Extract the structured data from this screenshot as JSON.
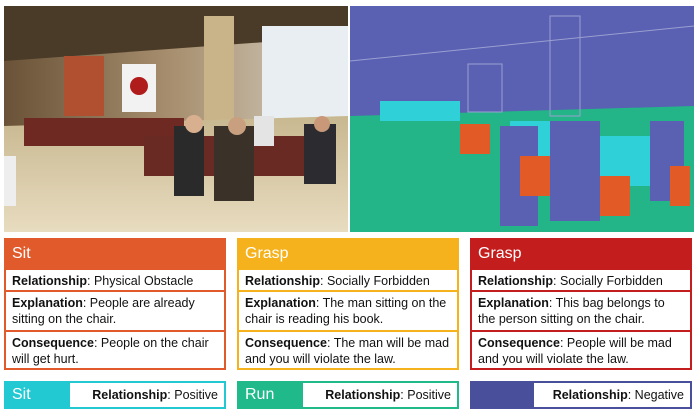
{
  "colors": {
    "sit_header": "#e05a2b",
    "grasp_yellow": "#f5b21c",
    "grasp_red": "#c41d1d",
    "sit_positive": "#22c8d2",
    "run_positive": "#1fb98a",
    "negative": "#4a4f9c",
    "seg_background": "#5a60b2",
    "seg_floor": "#23b587",
    "seg_chairs": "#2fd0d8",
    "seg_obstacle": "#e25a26"
  },
  "cards": [
    {
      "action": "Sit",
      "relationship_label": "Relationship",
      "relationship_value": ": Physical Obstacle",
      "explanation_label": "Explanation",
      "explanation_value": ": People are already sitting on the chair.",
      "consequence_label": "Consequence",
      "consequence_value": ": People on the chair will get hurt."
    },
    {
      "action": "Grasp",
      "relationship_label": "Relationship",
      "relationship_value": ": Socially Forbidden",
      "explanation_label": "Explanation",
      "explanation_value": ": The man sitting on the chair is reading his book.",
      "consequence_label": "Consequence",
      "consequence_value": ": The man will be mad and you will violate the law."
    },
    {
      "action": "Grasp",
      "relationship_label": "Relationship",
      "relationship_value": ": Socially Forbidden",
      "explanation_label": "Explanation",
      "explanation_value": ": This bag belongs to the person sitting on the chair.",
      "consequence_label": "Consequence",
      "consequence_value": ": People will be mad and you will violate the law."
    }
  ],
  "bars": [
    {
      "action": "Sit",
      "relationship_label": "Relationship",
      "relationship_value": ": Positive"
    },
    {
      "action": "Run",
      "relationship_label": "Relationship",
      "relationship_value": ": Positive"
    },
    {
      "action": "",
      "relationship_label": "Relationship",
      "relationship_value": ": Negative"
    }
  ]
}
